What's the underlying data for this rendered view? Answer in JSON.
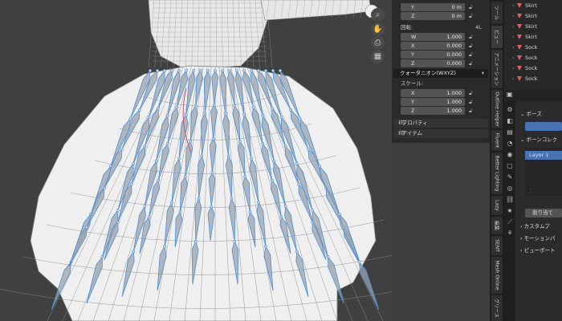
{
  "viewport": {
    "nav_icons": [
      "zoom-icon",
      "hand-pan-icon",
      "camera-icon",
      "grid-icon"
    ]
  },
  "n_panel": {
    "location_y": {
      "axis": "Y",
      "value": "0 m"
    },
    "location_z": {
      "axis": "Z",
      "value": "0 m"
    },
    "rotation_label": "回転:",
    "rotation_mode_short": "4L",
    "rotation": [
      {
        "axis": "W",
        "value": "1.000"
      },
      {
        "axis": "X",
        "value": "0.000"
      },
      {
        "axis": "Y",
        "value": "0.000"
      },
      {
        "axis": "Z",
        "value": "0.000"
      }
    ],
    "rotation_mode": "クォータニオン(WXYZ)",
    "scale_label": "スケール:",
    "scale": [
      {
        "axis": "X",
        "value": "1.000"
      },
      {
        "axis": "Y",
        "value": "1.000"
      },
      {
        "axis": "Z",
        "value": "1.000"
      }
    ],
    "properties_section": "プロパティ",
    "item_section": "アイテム"
  },
  "side_tabs": [
    "ツール",
    "ビュー",
    "アニメーション",
    "Outline Helper",
    "Fluent",
    "Better Lighting",
    "Lazy",
    "編集",
    "SENT",
    "Mesh Online",
    "グリース"
  ],
  "outliner": {
    "items": [
      "Skirt",
      "Skirt",
      "Skirt",
      "Skirt",
      "Sock",
      "Sock",
      "Sock",
      "Sock"
    ]
  },
  "properties": {
    "pose_label": "ポーズ",
    "bone_collection_label": "ボーンコレク",
    "layer_name": "Layer 1",
    "assign_button": "割り当て",
    "custom_props": "カスタムプ",
    "motion_paths": "モーションパ",
    "viewport_display": "ビューポート"
  },
  "colors": {
    "bone": "#9aa3ad",
    "bone_outline": "#4d8fd6",
    "accent": "#4772b3"
  }
}
